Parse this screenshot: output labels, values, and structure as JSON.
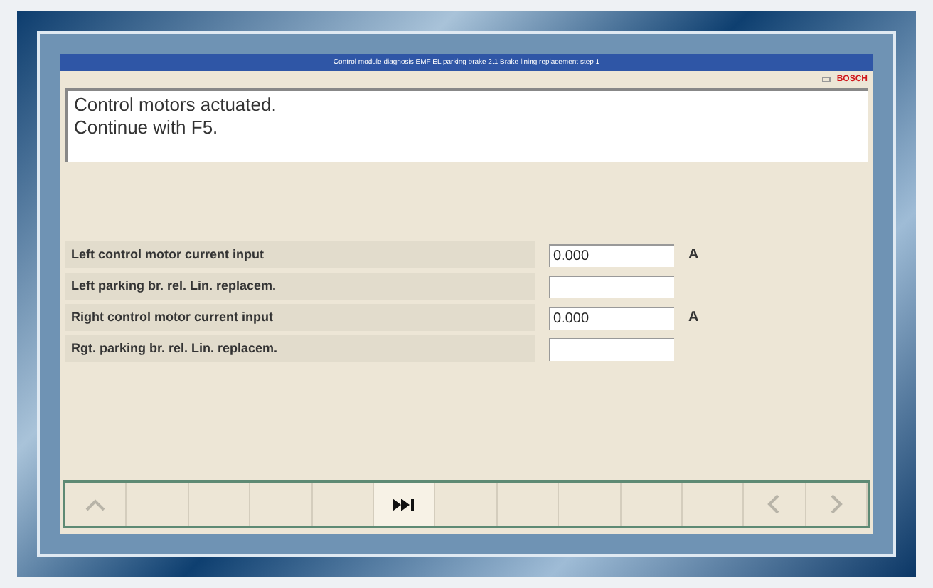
{
  "window": {
    "title": "Control module diagnosis EMF EL parking brake 2.1 Brake lining replacement step 1",
    "logo": "BOSCH"
  },
  "message": [
    "Control motors actuated.",
    "Continue with F5."
  ],
  "values": [
    {
      "label": "Left control motor current input",
      "value": "0.000",
      "unit": "A"
    },
    {
      "label": "Left parking br. rel. Lin. replacem."
    },
    {
      "label": "Right control motor current input",
      "value": "0.000",
      "unit": "A"
    },
    {
      "label": "Rgt. parking br. rel. Lin. replacem."
    }
  ],
  "function_keys": [
    {
      "kind": "up",
      "disabled": true
    },
    {
      "kind": "blank",
      "disabled": true
    },
    {
      "kind": "blank",
      "disabled": true
    },
    {
      "kind": "blank",
      "disabled": true
    },
    {
      "kind": "blank",
      "disabled": true
    },
    {
      "kind": "skip-forward",
      "disabled": false
    },
    {
      "kind": "blank",
      "disabled": true
    },
    {
      "kind": "blank",
      "disabled": true
    },
    {
      "kind": "blank",
      "disabled": true
    },
    {
      "kind": "blank",
      "disabled": true
    },
    {
      "kind": "blank",
      "disabled": true
    },
    {
      "kind": "left",
      "disabled": true
    },
    {
      "kind": "right",
      "disabled": true
    }
  ]
}
